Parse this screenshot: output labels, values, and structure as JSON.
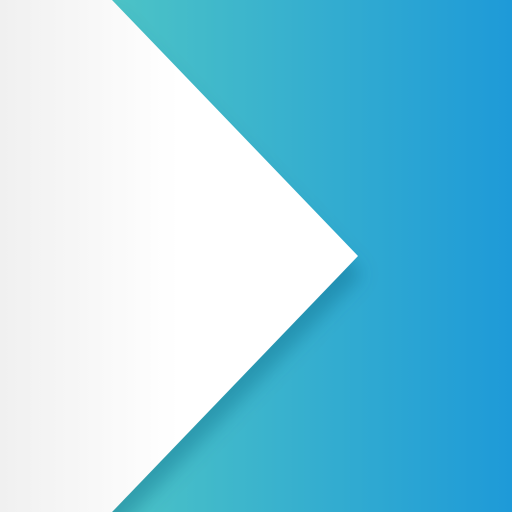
{
  "graphic": {
    "icon": "play-chevron-icon",
    "colors": {
      "teal": "#4cc3c6",
      "blue": "#1e9ad8",
      "white": "#ffffff",
      "light_gray": "#f0f0f0",
      "shadow": "#0d5a7a"
    }
  }
}
